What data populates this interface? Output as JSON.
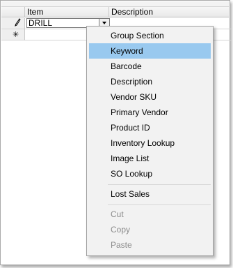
{
  "grid": {
    "columns": [
      "Item",
      "Description"
    ],
    "rows": [
      {
        "item_value": "DRILL",
        "selector_icon": "pencil-icon"
      },
      {
        "selector_icon": "asterisk-new-row-icon"
      }
    ],
    "new_row_glyph": "✳"
  },
  "context_menu": {
    "items": [
      {
        "label": "Group Section",
        "enabled": true,
        "highlighted": false
      },
      {
        "label": "Keyword",
        "enabled": true,
        "highlighted": true
      },
      {
        "label": "Barcode",
        "enabled": true,
        "highlighted": false
      },
      {
        "label": "Description",
        "enabled": true,
        "highlighted": false
      },
      {
        "label": "Vendor SKU",
        "enabled": true,
        "highlighted": false
      },
      {
        "label": "Primary Vendor",
        "enabled": true,
        "highlighted": false
      },
      {
        "label": "Product ID",
        "enabled": true,
        "highlighted": false
      },
      {
        "label": "Inventory Lookup",
        "enabled": true,
        "highlighted": false
      },
      {
        "label": "Image List",
        "enabled": true,
        "highlighted": false
      },
      {
        "label": "SO Lookup",
        "enabled": true,
        "highlighted": false
      },
      {
        "label": "Lost Sales",
        "enabled": true,
        "highlighted": false
      },
      {
        "label": "Cut",
        "enabled": false,
        "highlighted": false
      },
      {
        "label": "Copy",
        "enabled": false,
        "highlighted": false
      },
      {
        "label": "Paste",
        "enabled": false,
        "highlighted": false
      }
    ],
    "highlight_color": "#99c9ef"
  }
}
